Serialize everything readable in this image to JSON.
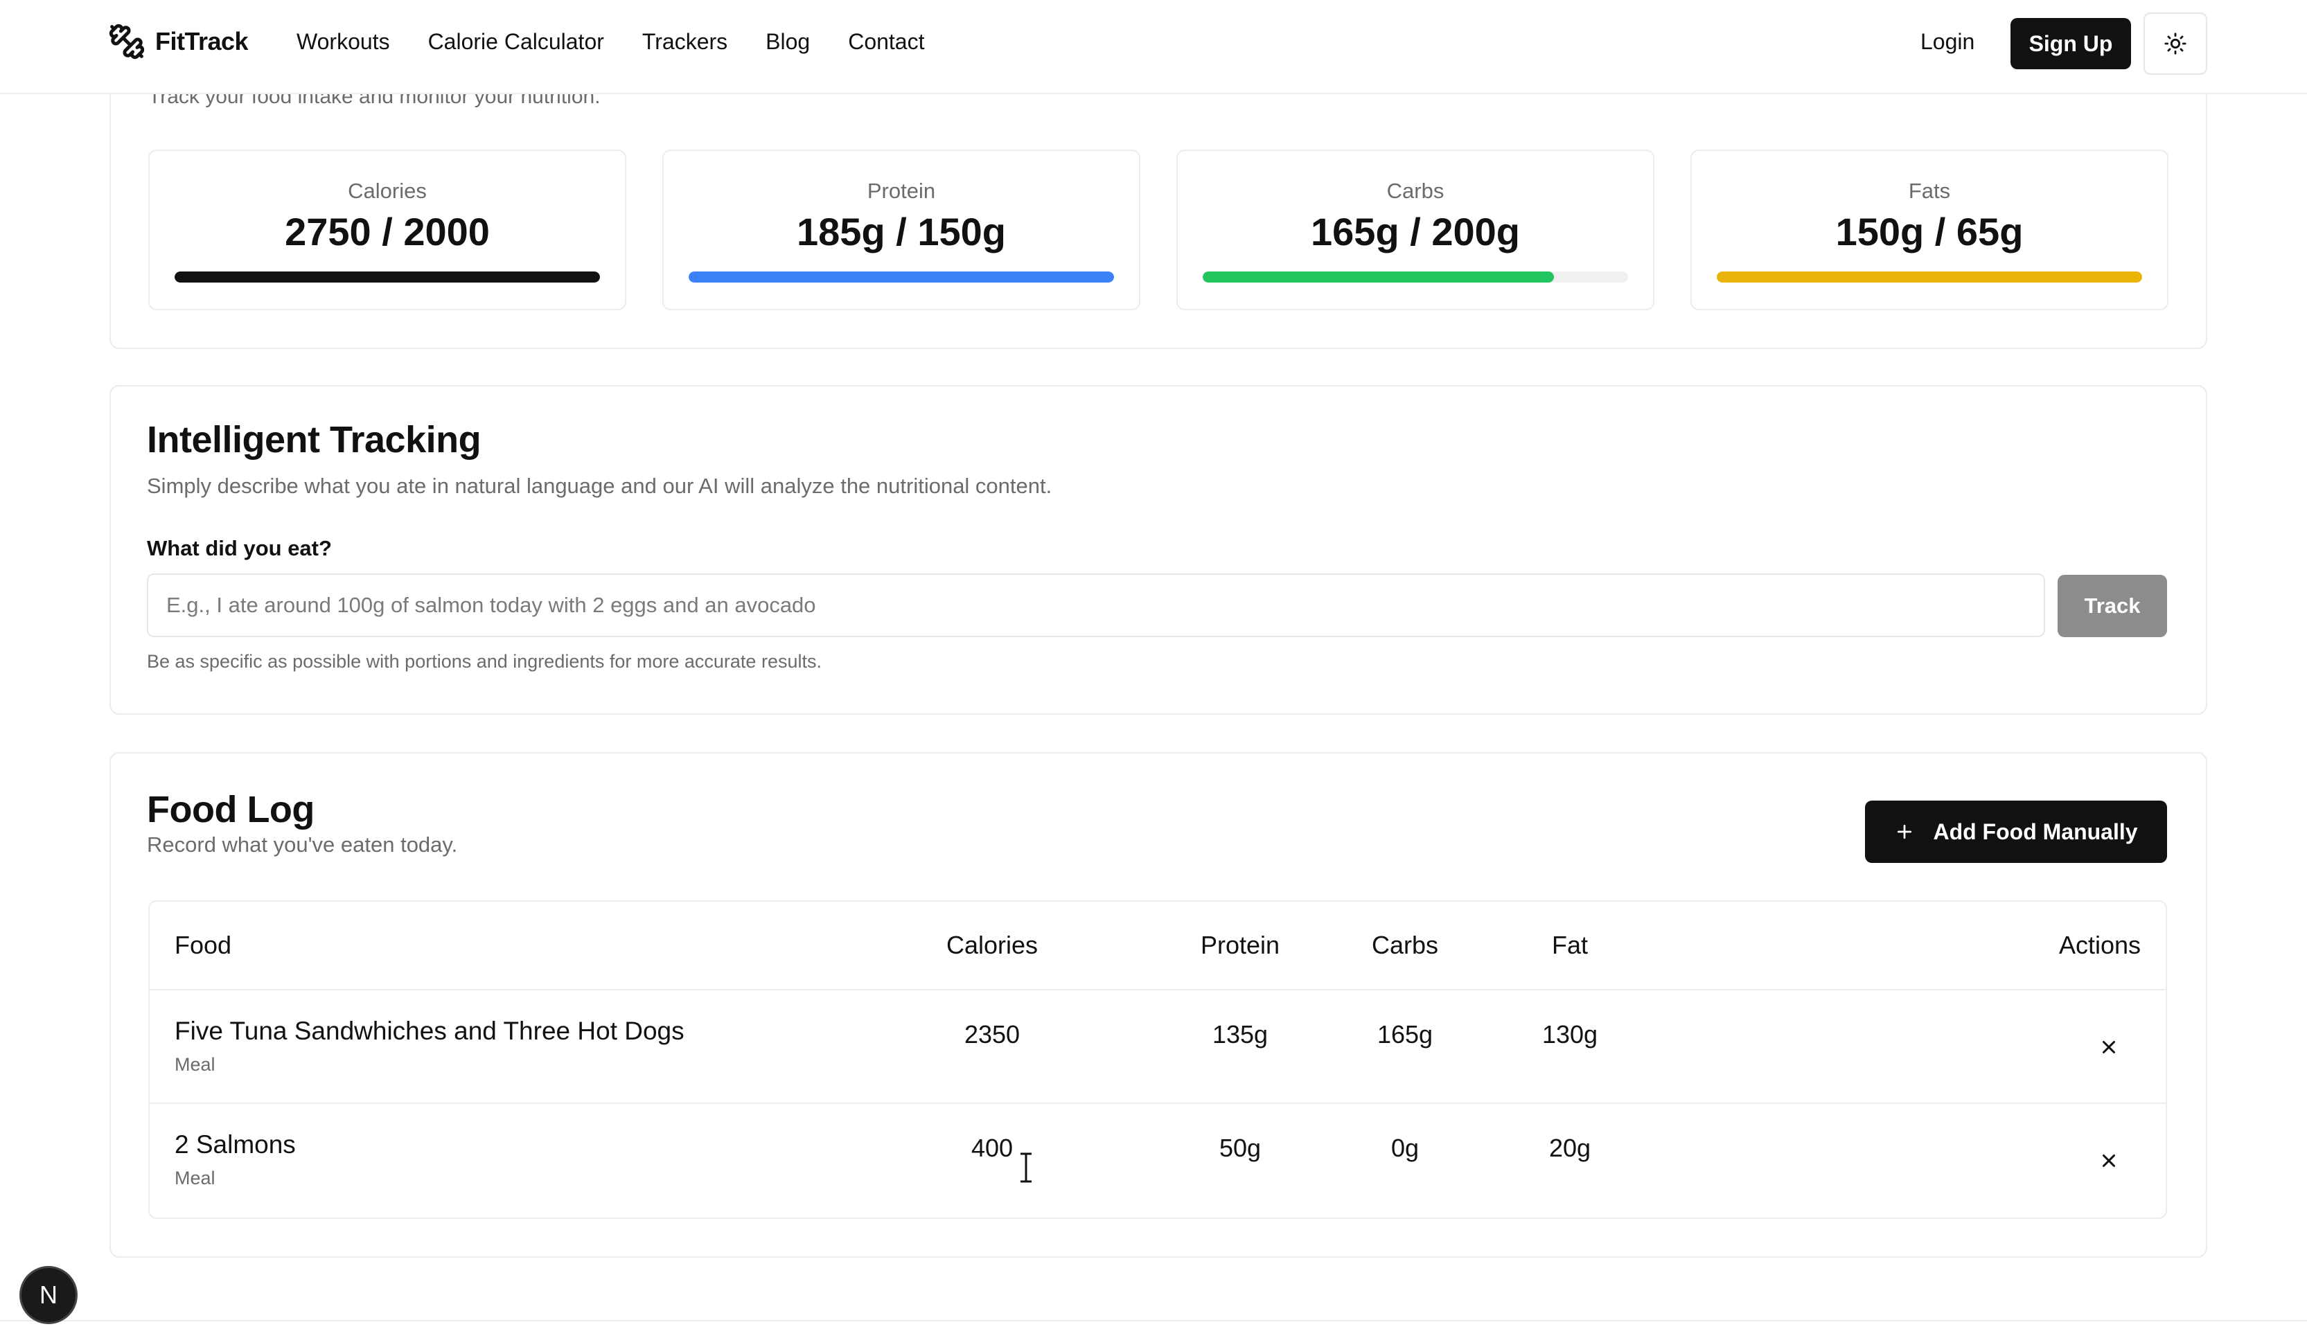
{
  "nav": {
    "brand": "FitTrack",
    "links": [
      "Workouts",
      "Calorie Calculator",
      "Trackers",
      "Blog",
      "Contact"
    ],
    "login": "Login",
    "signup": "Sign Up",
    "theme_icon": "sun-icon"
  },
  "summary": {
    "subtitle": "Track your food intake and monitor your nutrition.",
    "stats": [
      {
        "label": "Calories",
        "value": "2750 / 2000",
        "progress": 1.0,
        "color": "#111111"
      },
      {
        "label": "Protein",
        "value": "185g / 150g",
        "progress": 1.0,
        "color": "#3b82f6"
      },
      {
        "label": "Carbs",
        "value": "165g / 200g",
        "progress": 0.825,
        "color": "#22c55e"
      },
      {
        "label": "Fats",
        "value": "150g / 65g",
        "progress": 1.0,
        "color": "#eab308"
      }
    ]
  },
  "tracking": {
    "title": "Intelligent Tracking",
    "description": "Simply describe what you ate in natural language and our AI will analyze the nutritional content.",
    "field_label": "What did you eat?",
    "placeholder": "E.g., I ate around 100g of salmon today with 2 eggs and an avocado",
    "value": "",
    "button": "Track",
    "hint": "Be as specific as possible with portions and ingredients for more accurate results."
  },
  "food_log": {
    "title": "Food Log",
    "subtitle": "Record what you've eaten today.",
    "add_button": "Add Food Manually",
    "columns": [
      "Food",
      "Calories",
      "Protein",
      "Carbs",
      "Fat",
      "Actions"
    ],
    "rows": [
      {
        "food": "Five Tuna Sandwhiches and Three Hot Dogs",
        "type": "Meal",
        "calories": "2350",
        "protein": "135g",
        "carbs": "165g",
        "fat": "130g"
      },
      {
        "food": "2 Salmons",
        "type": "Meal",
        "calories": "400",
        "protein": "50g",
        "carbs": "0g",
        "fat": "20g"
      }
    ]
  },
  "badge": "N"
}
